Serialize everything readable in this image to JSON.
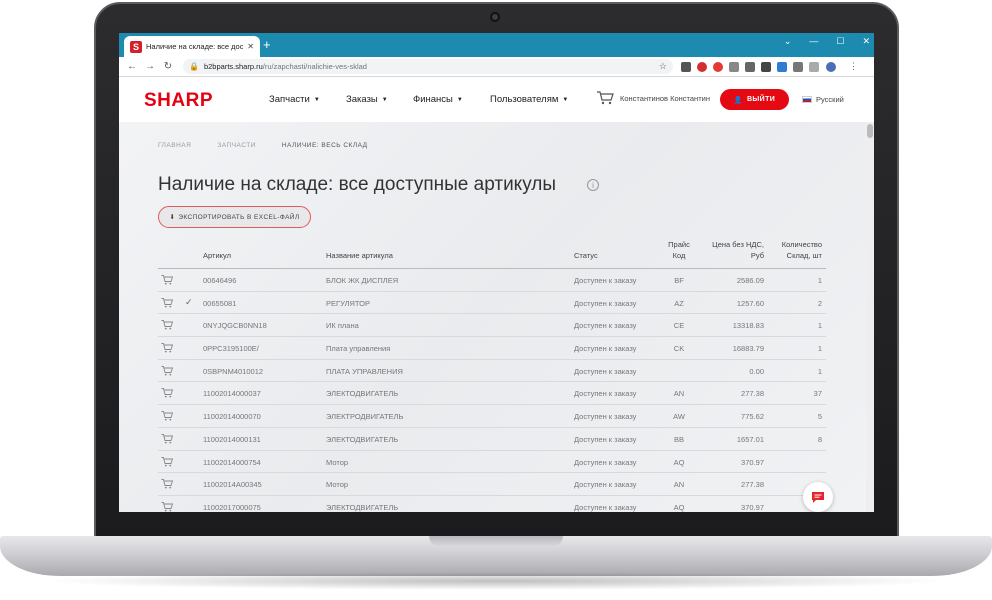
{
  "browser": {
    "tab_title": "Наличие на складе: все доступн",
    "tab_close": "✕",
    "new_tab": "+",
    "window_controls": [
      "⌄",
      "—",
      "☐",
      "✕"
    ],
    "url_host": "b2bparts.sharp.ru",
    "url_path": "/ru/zapchasti/nalichie-ves-sklad"
  },
  "header": {
    "logo": "SHARP",
    "nav": [
      "Запчасти",
      "Заказы",
      "Финансы",
      "Пользователям"
    ],
    "user_name": "Константинов Константин",
    "logout_label": "ВЫЙТИ",
    "language": "Русский"
  },
  "breadcrumb": [
    "ГЛАВНАЯ",
    "ЗАПЧАСТИ",
    "НАЛИЧИЕ: ВЕСЬ СКЛАД"
  ],
  "page_title": "Наличие на складе: все доступные артикулы",
  "info_icon": "i",
  "export_label": "ЭКСПОРТИРОВАТЬ В EXCEL-ФАЙЛ",
  "table": {
    "headers": {
      "sku": "Артикул",
      "name": "Название артикула",
      "status": "Статус",
      "price_code_1": "Прайс",
      "price_code_2": "Код",
      "net_price_1": "Цена без НДС,",
      "net_price_2": "Руб",
      "qty_1": "Количество",
      "qty_2": "Склад, шт"
    },
    "rows": [
      {
        "checked": false,
        "sku": "00646496",
        "name": "БЛОК ЖК ДИСПЛЕЯ",
        "status": "Доступен к заказу",
        "code": "BF",
        "price": "2586.09",
        "qty": "1"
      },
      {
        "checked": true,
        "sku": "00655081",
        "name": "РЕГУЛЯТОР",
        "status": "Доступен к заказу",
        "code": "AZ",
        "price": "1257.60",
        "qty": "2"
      },
      {
        "checked": false,
        "sku": "0NYJQGCB0NN18",
        "name": "ИК плана",
        "status": "Доступен к заказу",
        "code": "CE",
        "price": "13318.83",
        "qty": "1"
      },
      {
        "checked": false,
        "sku": "0PPC3195100E/",
        "name": "Плата управления",
        "status": "Доступен к заказу",
        "code": "CK",
        "price": "16883.79",
        "qty": "1"
      },
      {
        "checked": false,
        "sku": "0SBPNM4010012",
        "name": "ПЛАТА УПРАВЛЕНИЯ",
        "status": "Доступен к заказу",
        "code": "",
        "price": "0.00",
        "qty": "1"
      },
      {
        "checked": false,
        "sku": "11002014000037",
        "name": "ЭЛЕКТОДВИГАТЕЛЬ",
        "status": "Доступен к заказу",
        "code": "AN",
        "price": "277.38",
        "qty": "37"
      },
      {
        "checked": false,
        "sku": "11002014000070",
        "name": "ЭЛЕКТРОДВИГАТЕЛЬ",
        "status": "Доступен к заказу",
        "code": "AW",
        "price": "775.62",
        "qty": "5"
      },
      {
        "checked": false,
        "sku": "11002014000131",
        "name": "ЭЛЕКТОДВИГАТЕЛЬ",
        "status": "Доступен к заказу",
        "code": "BB",
        "price": "1657.01",
        "qty": "8"
      },
      {
        "checked": false,
        "sku": "11002014000754",
        "name": "Мотор",
        "status": "Доступен к заказу",
        "code": "AQ",
        "price": "370.97",
        "qty": ""
      },
      {
        "checked": false,
        "sku": "11002014A00345",
        "name": "Мотор",
        "status": "Доступен к заказу",
        "code": "AN",
        "price": "277.38",
        "qty": ""
      },
      {
        "checked": false,
        "sku": "11002017000075",
        "name": "ЭЛЕКТОДВИГАТЕЛЬ",
        "status": "Доступен к заказу",
        "code": "AQ",
        "price": "370.97",
        "qty": "26"
      }
    ]
  },
  "colors": {
    "brand_red": "#e60012",
    "tab_strip": "#1d8bb0",
    "logout_red": "#e50914",
    "chat_red": "#e5262c"
  }
}
